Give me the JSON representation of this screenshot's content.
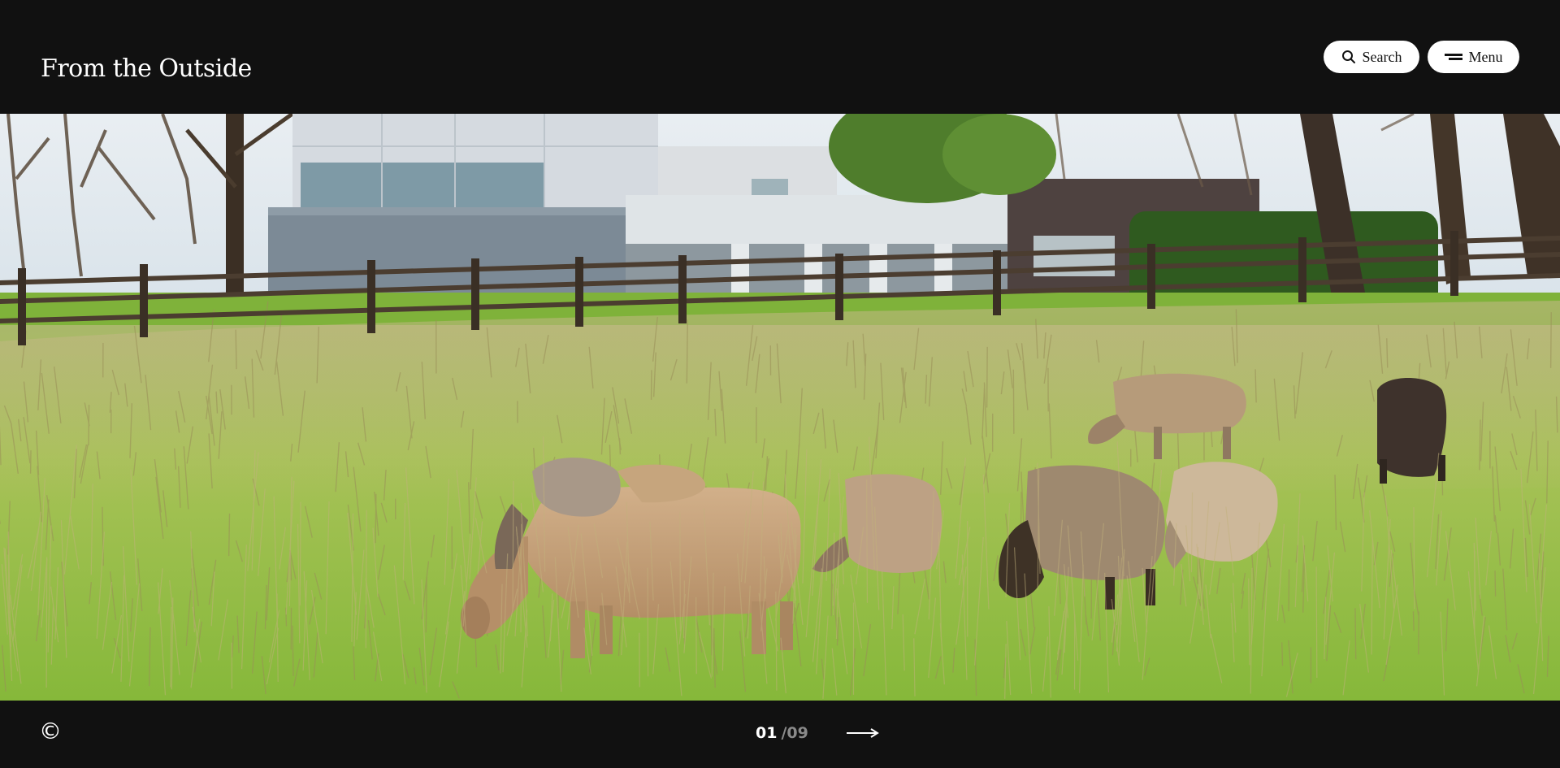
{
  "header": {
    "site_title": "From the Outside",
    "search_label": "Search",
    "menu_label": "Menu",
    "search_icon": "search-icon",
    "menu_icon": "menu-icon"
  },
  "hero": {
    "image": "sheep-grazing-meadow-modern-house-photo"
  },
  "footer": {
    "copyright_symbol": "©",
    "pager_current": "01",
    "pager_total": "/09",
    "next_icon": "arrow-right-icon"
  },
  "colors": {
    "background": "#111111",
    "pill": "#ffffff",
    "pager_muted": "#8a8a8a"
  }
}
